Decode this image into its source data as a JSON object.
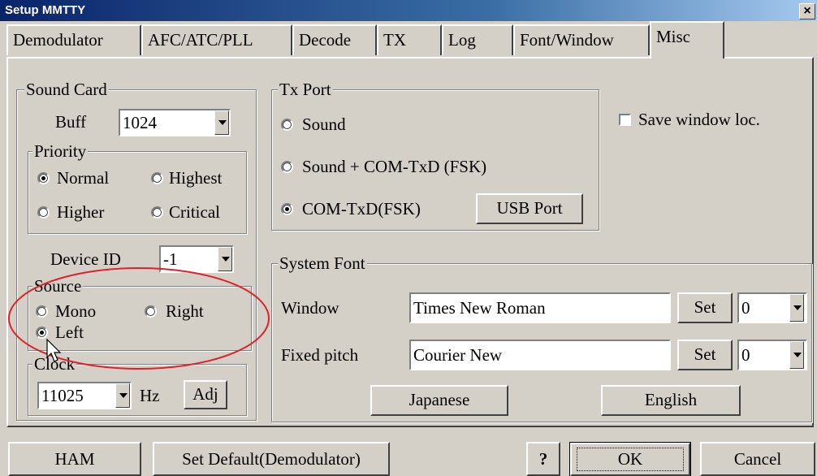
{
  "window": {
    "title": "Setup MMTTY",
    "close_glyph": "×"
  },
  "tabs": [
    "Demodulator",
    "AFC/ATC/PLL",
    "Decode",
    "TX",
    "Log",
    "Font/Window",
    "Misc"
  ],
  "active_tab": "Misc",
  "sound_card": {
    "legend": "Sound Card",
    "buff_label": "Buff",
    "buff_value": "1024",
    "priority": {
      "legend": "Priority",
      "options": [
        "Normal",
        "Highest",
        "Higher",
        "Critical"
      ],
      "selected": "Normal"
    },
    "device_id_label": "Device ID",
    "device_id_value": "-1",
    "source": {
      "legend": "Source",
      "options": [
        "Mono",
        "Right",
        "Left"
      ],
      "selected": "Left"
    },
    "clock": {
      "legend": "Clock",
      "value": "11025",
      "unit": "Hz",
      "adj_label": "Adj"
    }
  },
  "tx_port": {
    "legend": "Tx Port",
    "options": [
      "Sound",
      "Sound + COM-TxD (FSK)",
      "COM-TxD(FSK)"
    ],
    "selected": "COM-TxD(FSK)",
    "usb_button": "USB Port"
  },
  "save_window_loc": {
    "label": "Save window loc.",
    "checked": false
  },
  "system_font": {
    "legend": "System Font",
    "window_label": "Window",
    "window_font": "Times New Roman",
    "window_charset": "0",
    "fixed_label": "Fixed pitch",
    "fixed_font": "Courier New",
    "fixed_charset": "0",
    "set_label": "Set",
    "japanese_button": "Japanese",
    "english_button": "English"
  },
  "bottom_buttons": {
    "ham": "HAM",
    "set_default": "Set Default(Demodulator)",
    "help": "?",
    "ok": "OK",
    "cancel": "Cancel"
  },
  "annotation_color": "#e0202a"
}
